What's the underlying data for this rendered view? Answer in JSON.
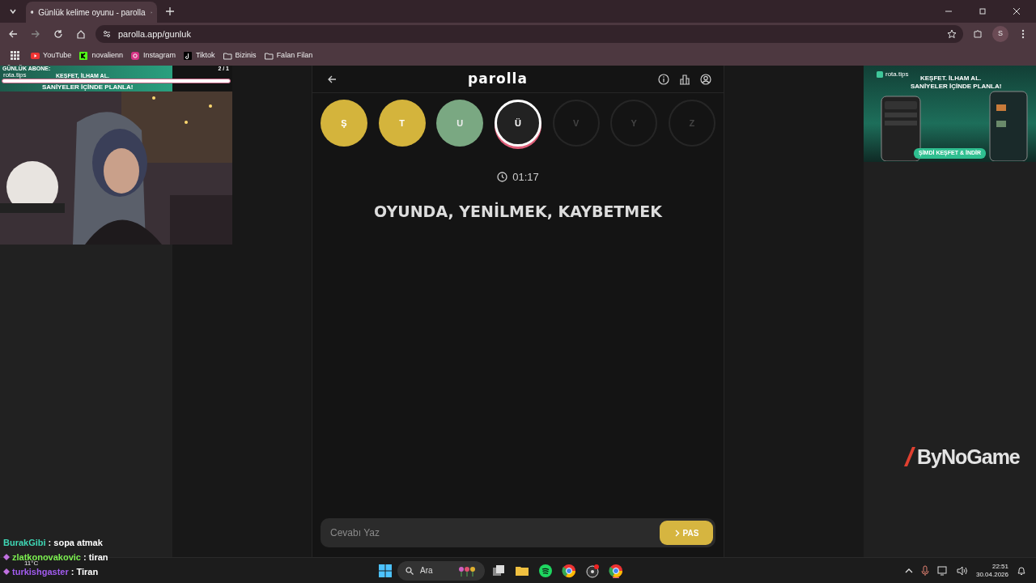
{
  "browser": {
    "tab_title": "Günlük kelime oyunu - parolla",
    "url": "parolla.app/gunluk",
    "profile": "S",
    "bookmarks": [
      {
        "label": "YouTube",
        "kind": "youtube"
      },
      {
        "label": "novalienn",
        "kind": "kick"
      },
      {
        "label": "Instagram",
        "kind": "instagram"
      },
      {
        "label": "Tiktok",
        "kind": "tiktok"
      },
      {
        "label": "Bizinis",
        "kind": "folder"
      },
      {
        "label": "Falan Filan",
        "kind": "folder"
      }
    ]
  },
  "game": {
    "title": "parolla",
    "letters": [
      {
        "letter": "Ş",
        "kind": "passed"
      },
      {
        "letter": "T",
        "kind": "passed"
      },
      {
        "letter": "U",
        "kind": "correct"
      },
      {
        "letter": "Ü",
        "kind": "current"
      },
      {
        "letter": "V",
        "kind": "pending"
      },
      {
        "letter": "Y",
        "kind": "pending"
      },
      {
        "letter": "Z",
        "kind": "pending"
      }
    ],
    "timer": "01:17",
    "clue": "OYUNDA, YENİLMEK, KAYBETMEK",
    "answer": {
      "placeholder": "Cevabı Yaz"
    },
    "pass_button": "PAS"
  },
  "overlay": {
    "sub_goal": {
      "label": "GÜNLÜK ABONE:",
      "count": "2 / 1",
      "level": 1
    },
    "left_ad": {
      "brand": "rota.tips",
      "line_1": "KEŞFET, İLHAM AL.",
      "line_2": "SANİYELER İÇİNDE PLANLA!"
    },
    "right_ad": {
      "brand": "rota.tips",
      "line_1": "KEŞFET. İLHAM AL.",
      "line_2": "SANİYELER İÇİNDE PLANLA!",
      "cta": "ŞİMDİ KEŞFET & İNDİR"
    },
    "sponsor": "ByNoGame",
    "chat": [
      {
        "user": "BurakGibi",
        "color": "#3fd7b5",
        "message": ": sopa atmak",
        "badge": false
      },
      {
        "user": "zlatkonovakovic",
        "color": "#7cf050",
        "message": ": tiran",
        "badge": true
      },
      {
        "user": "turkishgaster",
        "color": "#a25cf0",
        "message": ": Tiran",
        "badge": true
      }
    ],
    "weather": "11°C"
  },
  "taskbar": {
    "search": "Ara",
    "time": "22:51",
    "date": "30.04.2026"
  }
}
